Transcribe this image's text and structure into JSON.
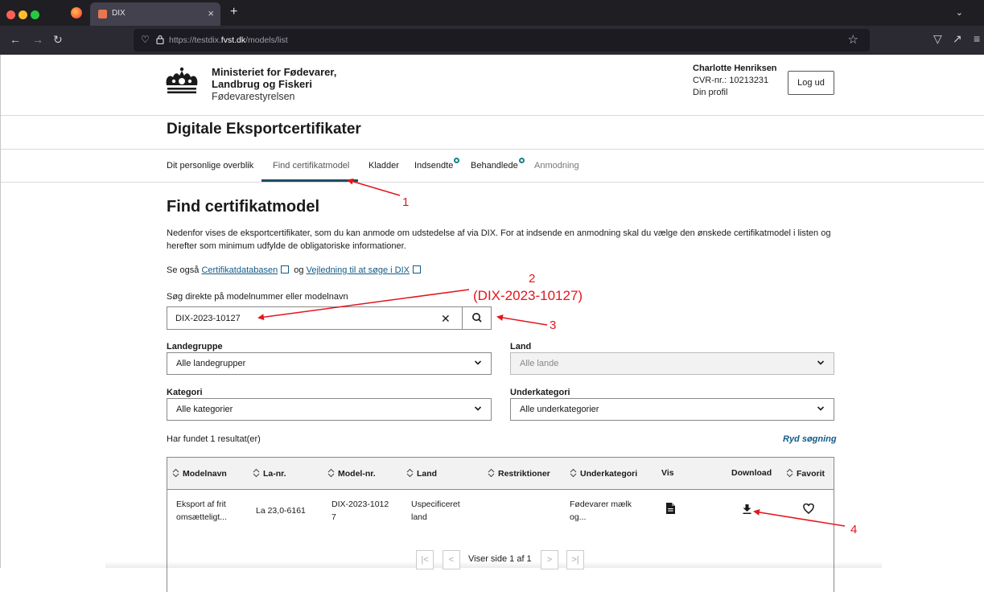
{
  "browser": {
    "tab_title": "DIX",
    "tab_close": "×",
    "new_tab": "+",
    "url_prefix": "https://testdix.",
    "url_domain": "fvst.dk",
    "url_path": "/models/list"
  },
  "header": {
    "ministry_line1": "Ministeriet for Fødevarer,",
    "ministry_line2": "Landbrug og Fiskeri",
    "ministry_line3": "Fødevarestyrelsen",
    "user_name": "Charlotte Henriksen",
    "cvr": "CVR-nr.: 10213231",
    "profile_link": "Din profil",
    "logout_label": "Log ud",
    "app_title": "Digitale Eksportcertifikater"
  },
  "nav": {
    "items": [
      {
        "label": "Dit personlige overblik"
      },
      {
        "label": "Find certifikatmodel"
      },
      {
        "label": "Kladder"
      },
      {
        "label": "Indsendte"
      },
      {
        "label": "Behandlede"
      },
      {
        "label": "Anmodning"
      }
    ]
  },
  "main": {
    "title": "Find certifikatmodel",
    "intro": "Nedenfor vises de eksportcertifikater, som du kan anmode om udstedelse af via DIX. For at indsende en anmodning skal du vælge den ønskede certifikatmodel i listen og herefter som minimum udfylde de obligatoriske informationer.",
    "see_also_prefix": "Se også",
    "link_certdb": "Certifikatdatabasen",
    "see_also_and": "og",
    "link_guide": "Vejledning til at søge i DIX",
    "search_label": "Søg direkte på modelnummer eller modelnavn",
    "search_value": "DIX-2023-10127",
    "clear_symbol": "✕",
    "filters": {
      "landegruppe_label": "Landegruppe",
      "landegruppe_value": "Alle landegrupper",
      "land_label": "Land",
      "land_value": "Alle lande",
      "kategori_label": "Kategori",
      "kategori_value": "Alle kategorier",
      "underkategori_label": "Underkategori",
      "underkategori_value": "Alle underkategorier"
    },
    "result_count": "Har fundet 1 resultat(er)",
    "clear_search": "Ryd søgning"
  },
  "table": {
    "headers": [
      "Modelnavn",
      "La-nr.",
      "Model-nr.",
      "Land",
      "Restriktioner",
      "Underkategori",
      "Vis",
      "Download",
      "Favorit"
    ],
    "row": {
      "modelnavn_1": "Eksport af frit",
      "modelnavn_2": "omsætteligt...",
      "la_nr": "La 23,0-6161",
      "model_nr_1": "DIX-2023-1012",
      "model_nr_2": "7",
      "land_1": "Uspecificeret",
      "land_2": "land",
      "underkategori_1": "Fødevarer mælk",
      "underkategori_2": "og..."
    }
  },
  "pager": {
    "first": "|<",
    "prev": "<",
    "text": "Viser side 1 af 1",
    "next": ">",
    "last": ">|"
  },
  "annotations": {
    "n1": "1",
    "n2": "2",
    "n2_text": "(DIX-2023-10127)",
    "n3": "3",
    "n4": "4",
    "color": "#e3161c"
  },
  "colors": {
    "accent": "#145b86",
    "active_tab_bar": "#1f4d66",
    "badge": "#177f87",
    "browser_dark": "#1f1e22"
  }
}
